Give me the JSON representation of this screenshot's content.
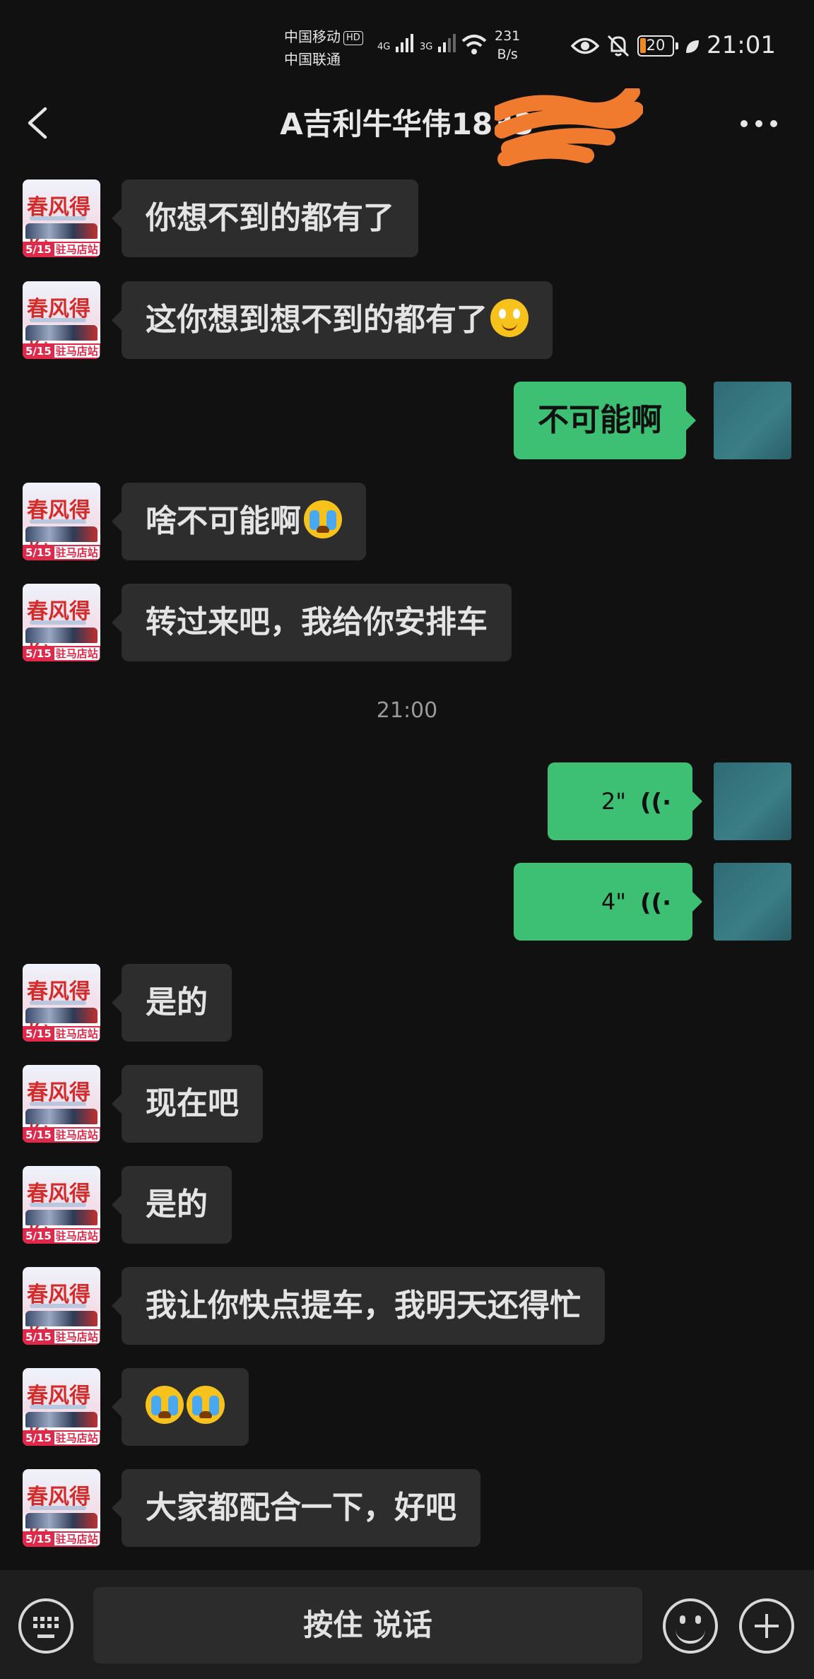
{
  "status_bar": {
    "carrier_1": "中国移动",
    "carrier_1_badge": "HD",
    "carrier_2": "中国联通",
    "net_1": "4G",
    "net_2": "3G",
    "speed_value": "231",
    "speed_unit": "B/s",
    "battery": "20",
    "time": "21:01"
  },
  "header": {
    "title": "A吉利牛华伟1833",
    "back_icon": "chevron-left-icon",
    "more_icon": "more-dots-icon"
  },
  "avatar_left": {
    "top_text": "春风得亿",
    "bottom_date": "5/15",
    "bottom_label": "驻马店站"
  },
  "messages": [
    {
      "side": "left",
      "text": "你想不到的都有了"
    },
    {
      "side": "left",
      "text": "这你想到想不到的都有了",
      "emoji": "smile"
    },
    {
      "side": "right",
      "text": "不可能啊"
    },
    {
      "side": "left",
      "text": "啥不可能啊",
      "emoji": "cry"
    },
    {
      "side": "left",
      "text": "转过来吧，我给你安排车"
    },
    {
      "side": "right",
      "type": "voice",
      "duration": "2\""
    },
    {
      "side": "right",
      "type": "voice",
      "duration": "4\""
    },
    {
      "side": "left",
      "text": "是的"
    },
    {
      "side": "left",
      "text": "现在吧"
    },
    {
      "side": "left",
      "text": "是的"
    },
    {
      "side": "left",
      "text": "我让你快点提车，我明天还得忙"
    },
    {
      "side": "left",
      "text": "",
      "emoji": "cry-cry"
    },
    {
      "side": "left",
      "text": "大家都配合一下，好吧"
    }
  ],
  "time_separator": "21:00",
  "bottom_bar": {
    "hold_to_talk": "按住 说话",
    "keyboard_icon": "keyboard-icon",
    "emoji_icon": "emoji-icon",
    "plus_icon": "plus-icon"
  }
}
